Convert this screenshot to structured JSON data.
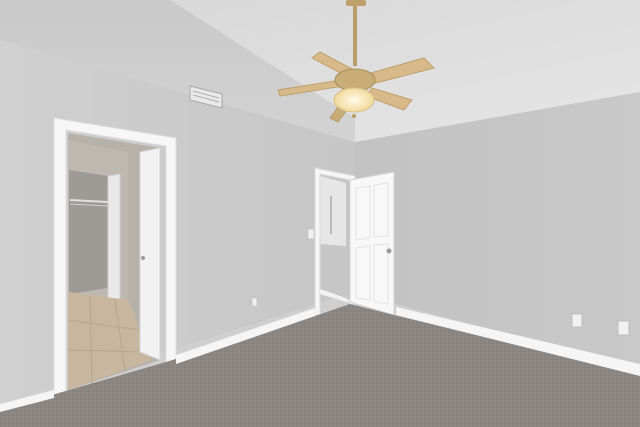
{
  "scene": {
    "colors": {
      "left_wall": "#cdcdcd",
      "right_wall": "#c3c3c3",
      "ceiling": "#e3e3e3",
      "ceiling_slope": "#d2d2d2",
      "carpet": "#8c8783",
      "trim": "#ffffff",
      "tile_floor": "#c8b79e",
      "fan_brass": "#bda06a",
      "fan_light": "#fff3c8"
    },
    "objects": [
      "ceiling-fan",
      "ceiling-vent",
      "bathroom-doorway",
      "closet",
      "bedroom-door",
      "light-switch",
      "electrical-outlet",
      "carpet-floor"
    ]
  }
}
